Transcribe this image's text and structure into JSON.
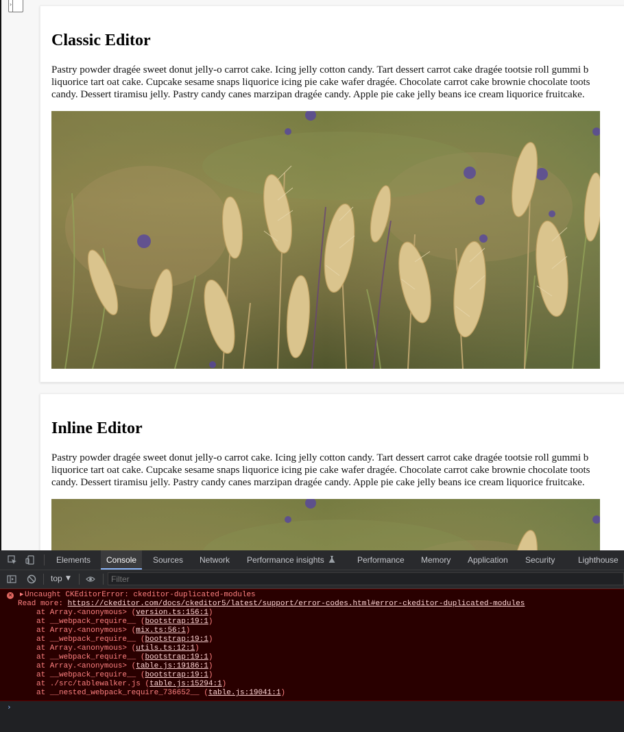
{
  "sections": [
    {
      "title": "Classic Editor",
      "lines": [
        "Pastry powder dragée sweet donut jelly-o carrot cake. Icing jelly cotton candy. Tart dessert carrot cake dragée tootsie roll gummi b",
        "liquorice tart oat cake. Cupcake sesame snaps liquorice icing pie cake wafer dragée. Chocolate carrot cake brownie chocolate toots",
        "candy. Dessert tiramisu jelly. Pastry candy canes marzipan dragée candy. Apple pie cake jelly beans ice cream liquorice fruitcake."
      ]
    },
    {
      "title": "Inline Editor",
      "lines": [
        "Pastry powder dragée sweet donut jelly-o carrot cake. Icing jelly cotton candy. Tart dessert carrot cake dragée tootsie roll gummi b",
        "liquorice tart oat cake. Cupcake sesame snaps liquorice icing pie cake wafer dragée. Chocolate carrot cake brownie chocolate toots",
        "candy. Dessert tiramisu jelly. Pastry candy canes marzipan dragée candy. Apple pie cake jelly beans ice cream liquorice fruitcake."
      ]
    }
  ],
  "devtools": {
    "tabs": [
      "Elements",
      "Console",
      "Sources",
      "Network",
      "Performance insights",
      "Performance",
      "Memory",
      "Application",
      "Security",
      "Lighthouse"
    ],
    "active_tab": "Console",
    "context": "top",
    "filter_placeholder": "Filter",
    "error": {
      "title": "Uncaught CKEditorError: ckeditor-duplicated-modules",
      "read_more_label": "Read more:",
      "read_more_url": "https://ckeditor.com/docs/ckeditor5/latest/support/error-codes.html#error-ckeditor-duplicated-modules",
      "stack": [
        {
          "prefix": "at Array.<anonymous> (",
          "link": "version.ts:156:1",
          "suffix": ")"
        },
        {
          "prefix": "at __webpack_require__ (",
          "link": "bootstrap:19:1",
          "suffix": ")"
        },
        {
          "prefix": "at Array.<anonymous> (",
          "link": "mix.ts:56:1",
          "suffix": ")"
        },
        {
          "prefix": "at __webpack_require__ (",
          "link": "bootstrap:19:1",
          "suffix": ")"
        },
        {
          "prefix": "at Array.<anonymous> (",
          "link": "utils.ts:12:1",
          "suffix": ")"
        },
        {
          "prefix": "at __webpack_require__ (",
          "link": "bootstrap:19:1",
          "suffix": ")"
        },
        {
          "prefix": "at Array.<anonymous> (",
          "link": "table.js:19186:1",
          "suffix": ")"
        },
        {
          "prefix": "at __webpack_require__ (",
          "link": "bootstrap:19:1",
          "suffix": ")"
        },
        {
          "prefix": "at ./src/tablewalker.js (",
          "link": "table.js:15294:1",
          "suffix": ")"
        },
        {
          "prefix": "at __nested_webpack_require_736652__ (",
          "link": "table.js:19041:1",
          "suffix": ")"
        }
      ]
    },
    "prompt": "›"
  }
}
